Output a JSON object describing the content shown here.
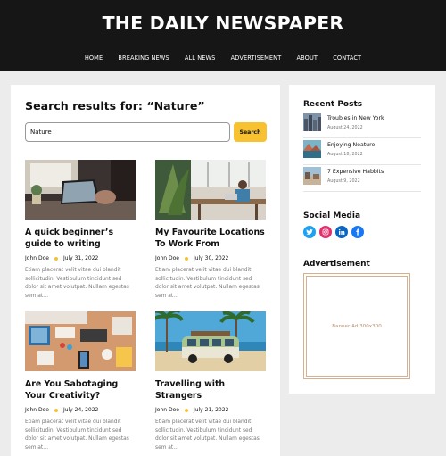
{
  "header": {
    "site_title": "THE DAILY NEWSPAPER",
    "nav": [
      "HOME",
      "BREAKING NEWS",
      "ALL NEWS",
      "ADVERTISEMENT",
      "ABOUT",
      "CONTACT"
    ]
  },
  "search": {
    "heading": "Search results for: “Nature”",
    "value": "Nature",
    "button_label": "Search"
  },
  "posts": [
    {
      "title": "A quick beginner’s guide to writing",
      "author": "John Doe",
      "date": "July 31, 2022",
      "excerpt": "Etiam placerat velit vitae dui blandit sollicitudin. Vestibulum tincidunt sed dolor sit amet volutpat. Nullam egestas sem at…",
      "image": "laptop-desk-photo"
    },
    {
      "title": "My Favourite Locations To Work From",
      "author": "John Doe",
      "date": "July 30, 2022",
      "excerpt": "Etiam placerat velit vitae dui blandit sollicitudin. Vestibulum tincidunt sed dolor sit amet volutpat. Nullam egestas sem at…",
      "image": "cafe-workspace-photo"
    },
    {
      "title": "Are You Sabotaging Your Creativity?",
      "author": "John Doe",
      "date": "July 24, 2022",
      "excerpt": "Etiam placerat velit vitae dui blandit sollicitudin. Vestibulum tincidunt sed dolor sit amet volutpat. Nullam egestas sem at…",
      "image": "creative-desk-photo"
    },
    {
      "title": "Travelling with Strangers",
      "author": "John Doe",
      "date": "July 21, 2022",
      "excerpt": "Etiam placerat velit vitae dui blandit sollicitudin. Vestibulum tincidunt sed dolor sit amet volutpat. Nullam egestas sem at…",
      "image": "beach-van-photo"
    }
  ],
  "sidebar": {
    "recent_heading": "Recent Posts",
    "recent": [
      {
        "title": "Troubles in New York",
        "date": "August 24, 2022"
      },
      {
        "title": "Enjoying Neature",
        "date": "August 18, 2022"
      },
      {
        "title": "7 Expensive Habbits",
        "date": "August 9, 2022"
      }
    ],
    "social_heading": "Social Media",
    "socials": [
      {
        "icon": "twitter-icon",
        "color": "#1da1f2"
      },
      {
        "icon": "instagram-icon",
        "color": "#e1306c"
      },
      {
        "icon": "linkedin-icon",
        "color": "#0a66c2"
      },
      {
        "icon": "facebook-icon",
        "color": "#1877f2"
      }
    ],
    "ad_heading": "Advertisement",
    "ad_text": "Banner Ad 300x300"
  },
  "colors": {
    "header_bg": "#161616",
    "accent": "#f7c12f",
    "page_bg": "#ececec"
  }
}
